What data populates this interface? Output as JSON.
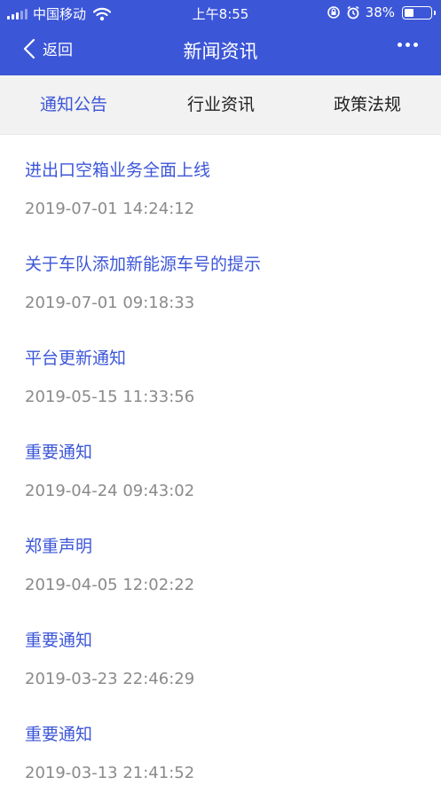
{
  "status_bar": {
    "carrier": "中国移动",
    "time": "上午8:55",
    "battery": "38%",
    "battery_level": 0.38
  },
  "nav": {
    "back_label": "返回",
    "title": "新闻资讯",
    "more_icon": "more-horizontal-icon"
  },
  "tabs": [
    {
      "label": "通知公告",
      "active": true
    },
    {
      "label": "行业资讯",
      "active": false
    },
    {
      "label": "政策法规",
      "active": false
    }
  ],
  "news": [
    {
      "title": "进出口空箱业务全面上线",
      "date": "2019-07-01 14:24:12"
    },
    {
      "title": "关于车队添加新能源车号的提示",
      "date": "2019-07-01 09:18:33"
    },
    {
      "title": "平台更新通知",
      "date": "2019-05-15 11:33:56"
    },
    {
      "title": "重要通知",
      "date": "2019-04-24 09:43:02"
    },
    {
      "title": "郑重声明",
      "date": "2019-04-05 12:02:22"
    },
    {
      "title": "重要通知",
      "date": "2019-03-23 22:46:29"
    },
    {
      "title": "重要通知",
      "date": "2019-03-13 21:41:52"
    }
  ],
  "colors": {
    "accent": "#3c56d8",
    "tab_bg": "#f2f2f2",
    "date_text": "#8a8a8a"
  }
}
